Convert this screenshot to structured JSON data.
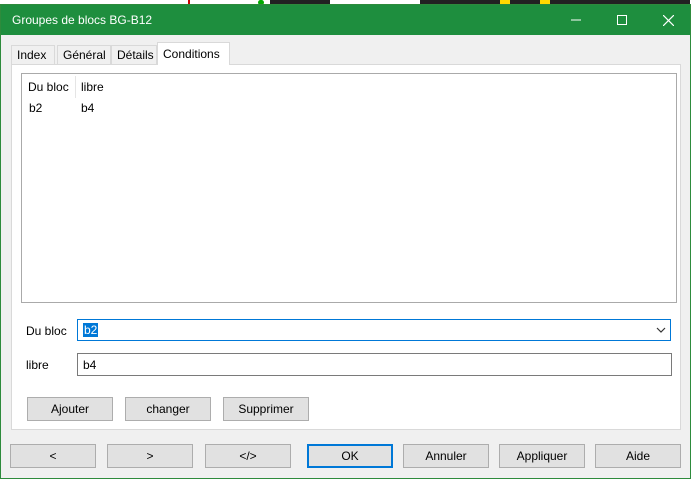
{
  "window": {
    "title": "Groupes de blocs BG-B12"
  },
  "titlebar": {
    "minimize_icon": "minimize-icon",
    "maximize_icon": "maximize-icon",
    "close_icon": "close-icon"
  },
  "tabs": [
    {
      "label": "Index"
    },
    {
      "label": "Général"
    },
    {
      "label": "Détails"
    },
    {
      "label": "Conditions",
      "active": true
    }
  ],
  "conditions": {
    "columns": [
      "Du bloc",
      "libre"
    ],
    "rows": [
      [
        "b2",
        "b4"
      ]
    ],
    "form": {
      "du_bloc_label": "Du bloc",
      "du_bloc_value": "b2",
      "libre_label": "libre",
      "libre_value": "b4"
    },
    "buttons": {
      "add": "Ajouter",
      "change": "changer",
      "delete": "Supprimer"
    }
  },
  "footer": {
    "prev": "<",
    "next": ">",
    "source": "</>",
    "ok": "OK",
    "cancel": "Annuler",
    "apply": "Appliquer",
    "help": "Aide"
  },
  "colors": {
    "titlebar": "#1e8e3e",
    "accent": "#0078d7"
  }
}
